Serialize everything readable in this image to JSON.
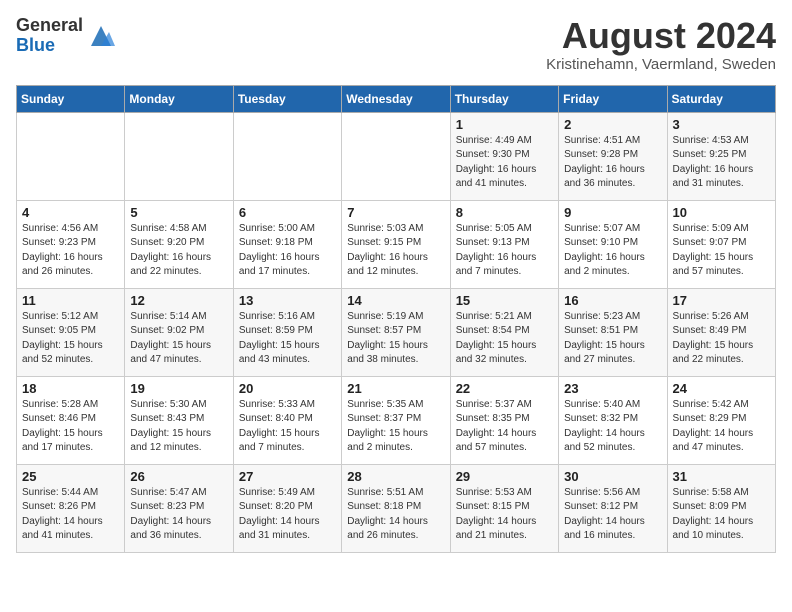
{
  "logo": {
    "general": "General",
    "blue": "Blue"
  },
  "title": "August 2024",
  "location": "Kristinehamn, Vaermland, Sweden",
  "days_of_week": [
    "Sunday",
    "Monday",
    "Tuesday",
    "Wednesday",
    "Thursday",
    "Friday",
    "Saturday"
  ],
  "weeks": [
    [
      {
        "day": "",
        "info": ""
      },
      {
        "day": "",
        "info": ""
      },
      {
        "day": "",
        "info": ""
      },
      {
        "day": "",
        "info": ""
      },
      {
        "day": "1",
        "info": "Sunrise: 4:49 AM\nSunset: 9:30 PM\nDaylight: 16 hours\nand 41 minutes."
      },
      {
        "day": "2",
        "info": "Sunrise: 4:51 AM\nSunset: 9:28 PM\nDaylight: 16 hours\nand 36 minutes."
      },
      {
        "day": "3",
        "info": "Sunrise: 4:53 AM\nSunset: 9:25 PM\nDaylight: 16 hours\nand 31 minutes."
      }
    ],
    [
      {
        "day": "4",
        "info": "Sunrise: 4:56 AM\nSunset: 9:23 PM\nDaylight: 16 hours\nand 26 minutes."
      },
      {
        "day": "5",
        "info": "Sunrise: 4:58 AM\nSunset: 9:20 PM\nDaylight: 16 hours\nand 22 minutes."
      },
      {
        "day": "6",
        "info": "Sunrise: 5:00 AM\nSunset: 9:18 PM\nDaylight: 16 hours\nand 17 minutes."
      },
      {
        "day": "7",
        "info": "Sunrise: 5:03 AM\nSunset: 9:15 PM\nDaylight: 16 hours\nand 12 minutes."
      },
      {
        "day": "8",
        "info": "Sunrise: 5:05 AM\nSunset: 9:13 PM\nDaylight: 16 hours\nand 7 minutes."
      },
      {
        "day": "9",
        "info": "Sunrise: 5:07 AM\nSunset: 9:10 PM\nDaylight: 16 hours\nand 2 minutes."
      },
      {
        "day": "10",
        "info": "Sunrise: 5:09 AM\nSunset: 9:07 PM\nDaylight: 15 hours\nand 57 minutes."
      }
    ],
    [
      {
        "day": "11",
        "info": "Sunrise: 5:12 AM\nSunset: 9:05 PM\nDaylight: 15 hours\nand 52 minutes."
      },
      {
        "day": "12",
        "info": "Sunrise: 5:14 AM\nSunset: 9:02 PM\nDaylight: 15 hours\nand 47 minutes."
      },
      {
        "day": "13",
        "info": "Sunrise: 5:16 AM\nSunset: 8:59 PM\nDaylight: 15 hours\nand 43 minutes."
      },
      {
        "day": "14",
        "info": "Sunrise: 5:19 AM\nSunset: 8:57 PM\nDaylight: 15 hours\nand 38 minutes."
      },
      {
        "day": "15",
        "info": "Sunrise: 5:21 AM\nSunset: 8:54 PM\nDaylight: 15 hours\nand 32 minutes."
      },
      {
        "day": "16",
        "info": "Sunrise: 5:23 AM\nSunset: 8:51 PM\nDaylight: 15 hours\nand 27 minutes."
      },
      {
        "day": "17",
        "info": "Sunrise: 5:26 AM\nSunset: 8:49 PM\nDaylight: 15 hours\nand 22 minutes."
      }
    ],
    [
      {
        "day": "18",
        "info": "Sunrise: 5:28 AM\nSunset: 8:46 PM\nDaylight: 15 hours\nand 17 minutes."
      },
      {
        "day": "19",
        "info": "Sunrise: 5:30 AM\nSunset: 8:43 PM\nDaylight: 15 hours\nand 12 minutes."
      },
      {
        "day": "20",
        "info": "Sunrise: 5:33 AM\nSunset: 8:40 PM\nDaylight: 15 hours\nand 7 minutes."
      },
      {
        "day": "21",
        "info": "Sunrise: 5:35 AM\nSunset: 8:37 PM\nDaylight: 15 hours\nand 2 minutes."
      },
      {
        "day": "22",
        "info": "Sunrise: 5:37 AM\nSunset: 8:35 PM\nDaylight: 14 hours\nand 57 minutes."
      },
      {
        "day": "23",
        "info": "Sunrise: 5:40 AM\nSunset: 8:32 PM\nDaylight: 14 hours\nand 52 minutes."
      },
      {
        "day": "24",
        "info": "Sunrise: 5:42 AM\nSunset: 8:29 PM\nDaylight: 14 hours\nand 47 minutes."
      }
    ],
    [
      {
        "day": "25",
        "info": "Sunrise: 5:44 AM\nSunset: 8:26 PM\nDaylight: 14 hours\nand 41 minutes."
      },
      {
        "day": "26",
        "info": "Sunrise: 5:47 AM\nSunset: 8:23 PM\nDaylight: 14 hours\nand 36 minutes."
      },
      {
        "day": "27",
        "info": "Sunrise: 5:49 AM\nSunset: 8:20 PM\nDaylight: 14 hours\nand 31 minutes."
      },
      {
        "day": "28",
        "info": "Sunrise: 5:51 AM\nSunset: 8:18 PM\nDaylight: 14 hours\nand 26 minutes."
      },
      {
        "day": "29",
        "info": "Sunrise: 5:53 AM\nSunset: 8:15 PM\nDaylight: 14 hours\nand 21 minutes."
      },
      {
        "day": "30",
        "info": "Sunrise: 5:56 AM\nSunset: 8:12 PM\nDaylight: 14 hours\nand 16 minutes."
      },
      {
        "day": "31",
        "info": "Sunrise: 5:58 AM\nSunset: 8:09 PM\nDaylight: 14 hours\nand 10 minutes."
      }
    ]
  ]
}
